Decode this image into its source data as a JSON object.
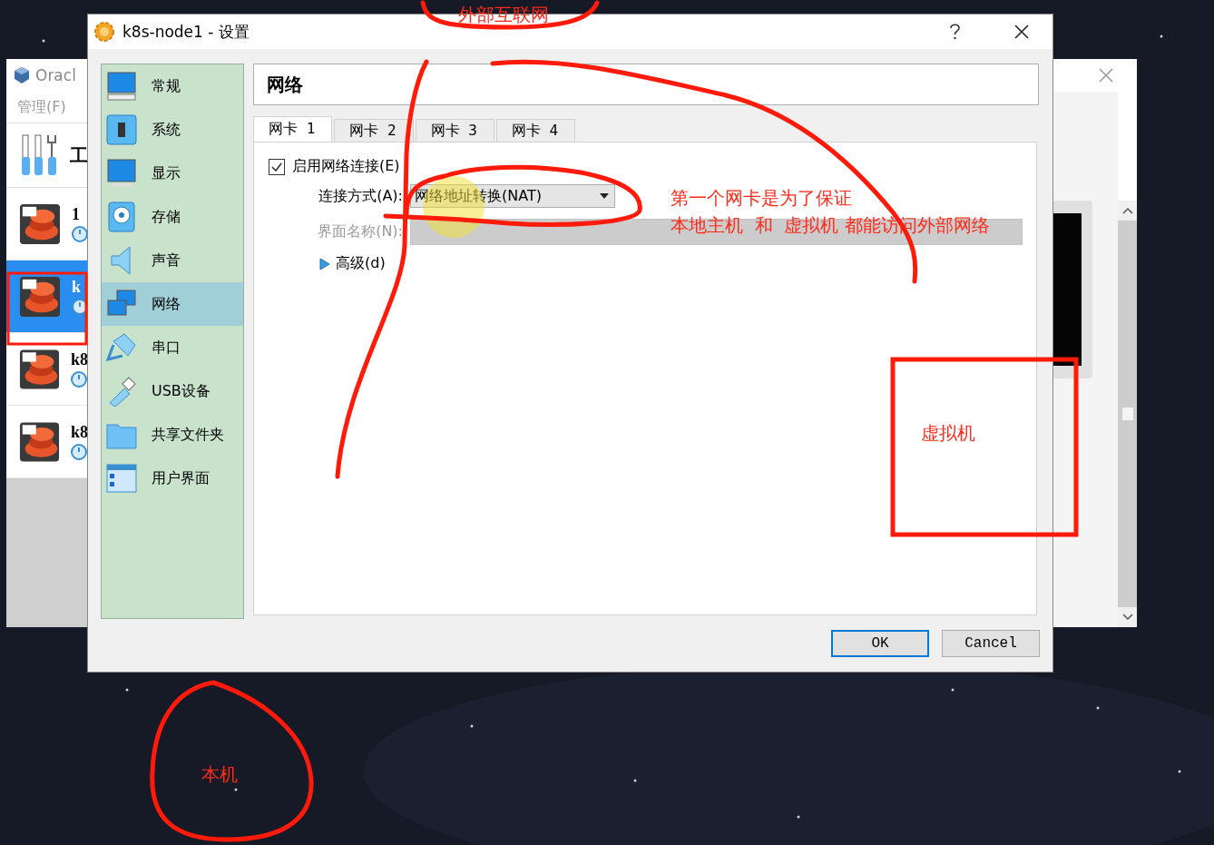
{
  "manager": {
    "title": "Oracl",
    "menu": "管理(F)",
    "tools_label": "工",
    "machines": [
      {
        "name": "1",
        "selected": false
      },
      {
        "name": "k",
        "selected": true
      },
      {
        "name": "k8",
        "selected": false
      },
      {
        "name": "k8",
        "selected": false
      }
    ]
  },
  "dialog": {
    "title": "k8s-node1 - 设置",
    "sidebar": {
      "items": [
        {
          "label": "常规",
          "selected": false
        },
        {
          "label": "系统",
          "selected": false
        },
        {
          "label": "显示",
          "selected": false
        },
        {
          "label": "存储",
          "selected": false
        },
        {
          "label": "声音",
          "selected": false
        },
        {
          "label": "网络",
          "selected": true
        },
        {
          "label": "串口",
          "selected": false
        },
        {
          "label": "USB设备",
          "selected": false
        },
        {
          "label": "共享文件夹",
          "selected": false
        },
        {
          "label": "用户界面",
          "selected": false
        }
      ]
    },
    "header": "网络",
    "tabs": [
      {
        "label": "网卡 1",
        "selected": true
      },
      {
        "label": "网卡 2",
        "selected": false
      },
      {
        "label": "网卡 3",
        "selected": false
      },
      {
        "label": "网卡 4",
        "selected": false
      }
    ],
    "enable": {
      "label": "启用网络连接(E)",
      "checked": true
    },
    "attached_to": {
      "label": "连接方式(A):",
      "value": "网络地址转换(NAT)"
    },
    "interface_name": {
      "label": "界面名称(N):",
      "disabled": true
    },
    "advanced": {
      "label": "高级(d)",
      "expanded": false
    },
    "buttons": [
      {
        "label": "OK",
        "default": true
      },
      {
        "label": "Cancel",
        "default": false
      }
    ]
  },
  "annotations": {
    "top_label": "外部互联网",
    "note_lines": [
      "第一个网卡是为了保证",
      "本地主机  和  虚拟机 都能访问外部网络"
    ],
    "vm_label": "虚拟机",
    "host_label": "本机"
  }
}
